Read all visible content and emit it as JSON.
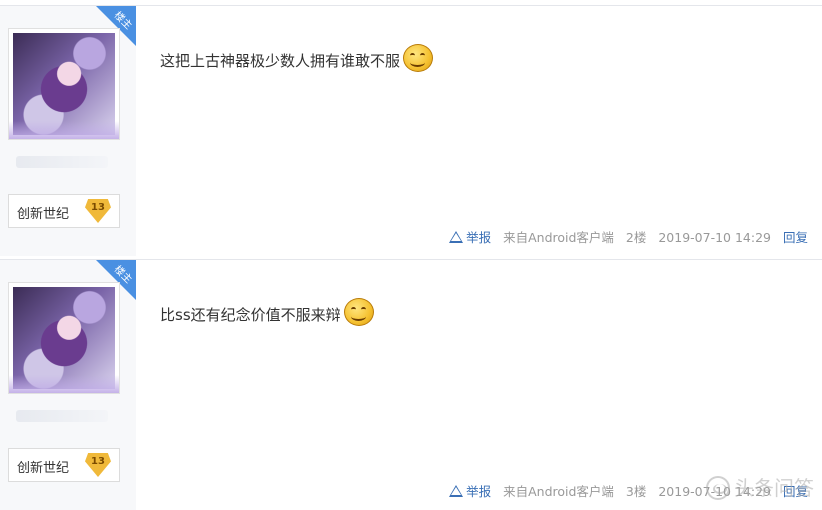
{
  "posts": [
    {
      "ribbon": "楼主",
      "level_name": "创新世纪",
      "level_num": "13",
      "content": "这把上古神器极少数人拥有谁敢不服",
      "footer": {
        "report": "举报",
        "source": "来自Android客户端",
        "floor": "2楼",
        "time": "2019-07-10 14:29",
        "reply": "回复"
      }
    },
    {
      "ribbon": "楼主",
      "level_name": "创新世纪",
      "level_num": "13",
      "content": "比ss还有纪念价值不服来辩",
      "footer": {
        "report": "举报",
        "source": "来自Android客户端",
        "floor": "3楼",
        "time": "2019-07-10 14:29",
        "reply": "回复"
      }
    }
  ],
  "watermark": "头条问答",
  "icons": {
    "emoji": "smile-emoji-icon",
    "report": "warning-triangle-icon",
    "watermark": "toutiao-logo-icon"
  },
  "colors": {
    "ribbon": "#4a90e2",
    "link": "#3a6fb5",
    "level_badge": "#f0b93a"
  }
}
